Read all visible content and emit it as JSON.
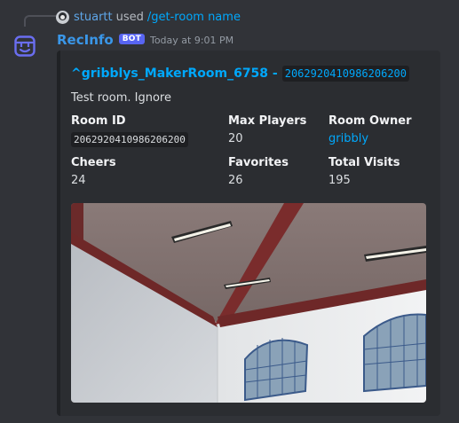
{
  "reply": {
    "username": "stuartt",
    "used_text": "used",
    "command": "/get-room name"
  },
  "message": {
    "username": "RecInfo",
    "bot_tag": "BOT",
    "timestamp": "Today at 9:01 PM"
  },
  "embed": {
    "title": "^gribblys_MakerRoom_6758 -",
    "title_code": "2062920410986206200",
    "description": "Test room. Ignore",
    "fields": [
      {
        "name": "Room ID",
        "value": "2062920410986206200"
      },
      {
        "name": "Max Players",
        "value": "20"
      },
      {
        "name": "Room Owner",
        "value": "gribbly"
      },
      {
        "name": "Cheers",
        "value": "24"
      },
      {
        "name": "Favorites",
        "value": "26"
      },
      {
        "name": "Total Visits",
        "value": "195"
      }
    ],
    "image_icon": "room-screenshot-image"
  },
  "colors": {
    "background": "#313338",
    "embed_bg": "#2b2d31",
    "link": "#00a8fc",
    "bot_tag": "#5865f2",
    "username": "#3a97e9"
  }
}
